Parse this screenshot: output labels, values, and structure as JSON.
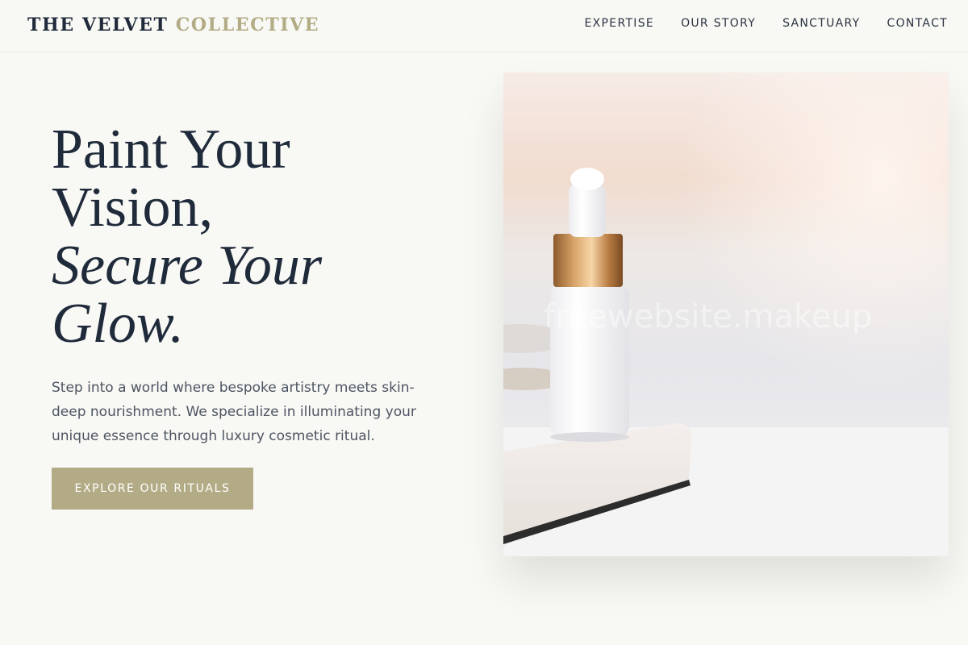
{
  "brand": {
    "name_primary": "THE VELVET",
    "name_accent": "COLLECTIVE",
    "colors": {
      "ink": "#1f2a3a",
      "accent": "#b3ab85",
      "background": "#f8f8f4"
    }
  },
  "nav": {
    "items": [
      {
        "label": "EXPERTISE"
      },
      {
        "label": "OUR STORY"
      },
      {
        "label": "SANCTUARY"
      },
      {
        "label": "CONTACT"
      }
    ]
  },
  "hero": {
    "headline_line1": "Paint Your",
    "headline_line2": "Vision,",
    "headline_line3": "Secure Your",
    "headline_line4": "Glow.",
    "description": "Step into a world where bespoke artistry meets skin-deep nourishment. We specialize in illuminating your unique essence through luxury cosmetic ritual.",
    "cta_label": "EXPLORE OUR RITUALS"
  },
  "image": {
    "subject": "serum-dropper-bottle-photo",
    "watermark": "freewebsite.makeup"
  }
}
